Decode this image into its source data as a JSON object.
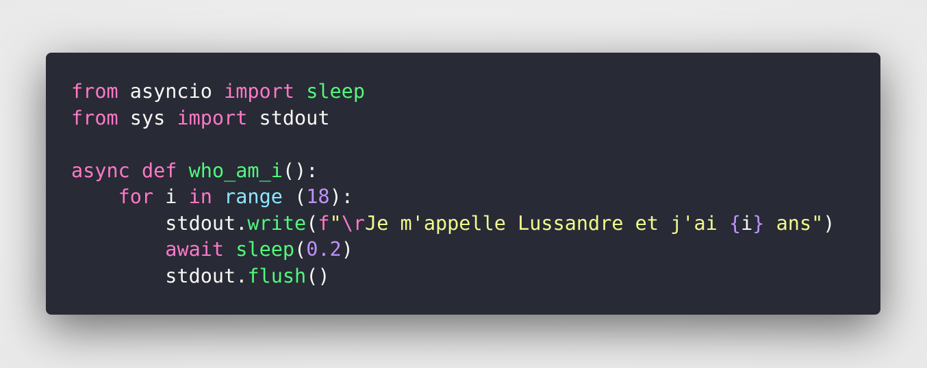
{
  "colors": {
    "background": "#282a36",
    "keyword": "#ff79c6",
    "function": "#50fa7b",
    "builtin": "#8be9fd",
    "number": "#bd93f9",
    "string": "#f1fa8c",
    "text": "#f8f8f2"
  },
  "code_lines": [
    [
      {
        "t": "from",
        "k": "kw"
      },
      {
        "t": " asyncio ",
        "k": "txt"
      },
      {
        "t": "import",
        "k": "kw"
      },
      {
        "t": " ",
        "k": "txt"
      },
      {
        "t": "sleep",
        "k": "fn"
      }
    ],
    [
      {
        "t": "from",
        "k": "kw"
      },
      {
        "t": " sys ",
        "k": "txt"
      },
      {
        "t": "import",
        "k": "kw"
      },
      {
        "t": " stdout",
        "k": "txt"
      }
    ],
    [],
    [
      {
        "t": "async",
        "k": "kw"
      },
      {
        "t": " ",
        "k": "txt"
      },
      {
        "t": "def",
        "k": "kw"
      },
      {
        "t": " ",
        "k": "txt"
      },
      {
        "t": "who_am_i",
        "k": "fn"
      },
      {
        "t": "():",
        "k": "txt"
      }
    ],
    [
      {
        "t": "    ",
        "k": "txt"
      },
      {
        "t": "for",
        "k": "kw"
      },
      {
        "t": " i ",
        "k": "txt"
      },
      {
        "t": "in",
        "k": "kw"
      },
      {
        "t": " ",
        "k": "txt"
      },
      {
        "t": "range",
        "k": "bi"
      },
      {
        "t": " (",
        "k": "txt"
      },
      {
        "t": "18",
        "k": "num"
      },
      {
        "t": "):",
        "k": "txt"
      }
    ],
    [
      {
        "t": "        stdout.",
        "k": "txt"
      },
      {
        "t": "write",
        "k": "fn"
      },
      {
        "t": "(",
        "k": "txt"
      },
      {
        "t": "f",
        "k": "kw"
      },
      {
        "t": "\"",
        "k": "str"
      },
      {
        "t": "\\r",
        "k": "kw"
      },
      {
        "t": "Je m'appelle Lussandre et j'ai ",
        "k": "str"
      },
      {
        "t": "{",
        "k": "num"
      },
      {
        "t": "i",
        "k": "txt"
      },
      {
        "t": "}",
        "k": "num"
      },
      {
        "t": " ans\"",
        "k": "str"
      },
      {
        "t": ")",
        "k": "txt"
      }
    ],
    [
      {
        "t": "        ",
        "k": "txt"
      },
      {
        "t": "await",
        "k": "kw"
      },
      {
        "t": " ",
        "k": "txt"
      },
      {
        "t": "sleep",
        "k": "fn"
      },
      {
        "t": "(",
        "k": "txt"
      },
      {
        "t": "0.2",
        "k": "num"
      },
      {
        "t": ")",
        "k": "txt"
      }
    ],
    [
      {
        "t": "        stdout.",
        "k": "txt"
      },
      {
        "t": "flush",
        "k": "fn"
      },
      {
        "t": "()",
        "k": "txt"
      }
    ]
  ]
}
